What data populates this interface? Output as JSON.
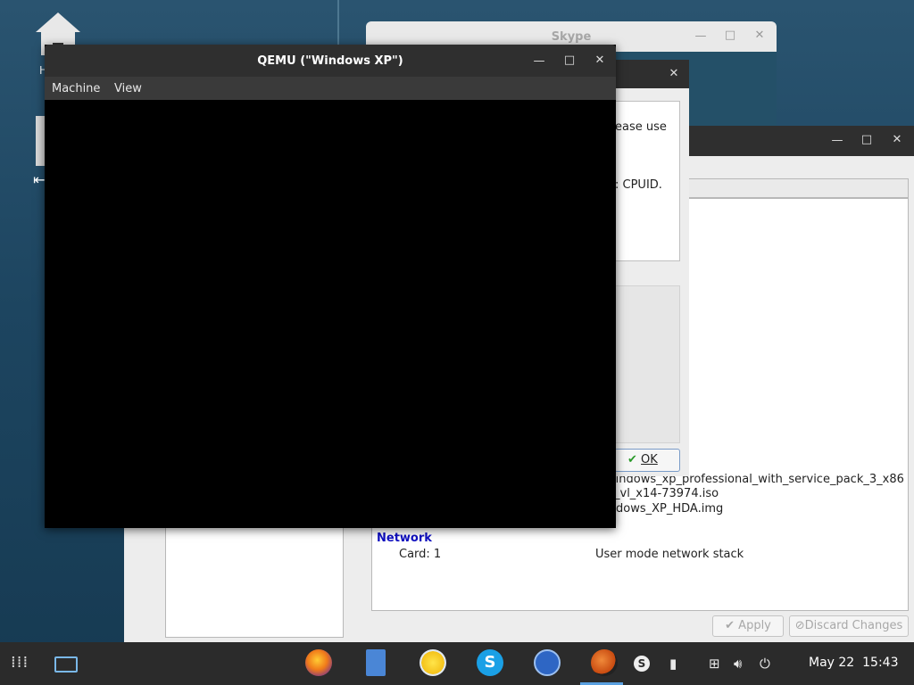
{
  "desktop": {
    "home_label": "H"
  },
  "skype_window": {
    "title": "Skype",
    "minimize": "—",
    "maximize": "□",
    "close": "✕"
  },
  "vm_window": {
    "minimize": "—",
    "maximize": "□",
    "close": "✕",
    "storage_lines": [
      "windows_xp_professional_with_service_pack_3_x86",
      "_vl_x14-73974.iso",
      "dows_XP_HDA.img"
    ],
    "network": {
      "heading": "Network",
      "card_label": "Card: 1",
      "card_value": "User mode network stack"
    },
    "apply_label": "Apply",
    "discard_label": "Discard Changes"
  },
  "dialog": {
    "close": "✕",
    "message_line1": "ease use",
    "message_line2": ": CPUID.",
    "ok_label": "OK"
  },
  "qemu_window": {
    "title": "QEMU (\"Windows XP\")",
    "minimize": "—",
    "maximize": "□",
    "close": "✕",
    "menu": [
      "Machine",
      "View"
    ]
  },
  "taskbar": {
    "clock_date": "May 22",
    "clock_time": "15:43",
    "apps": [
      "firefox-icon",
      "files-icon",
      "weather-icon",
      "skype-icon",
      "vpn-icon",
      "qemu-icon"
    ]
  },
  "colors": {
    "titlebar": "#2f2f2f",
    "section_heading": "#1010c0",
    "taskbar": "#2b2b2b"
  }
}
